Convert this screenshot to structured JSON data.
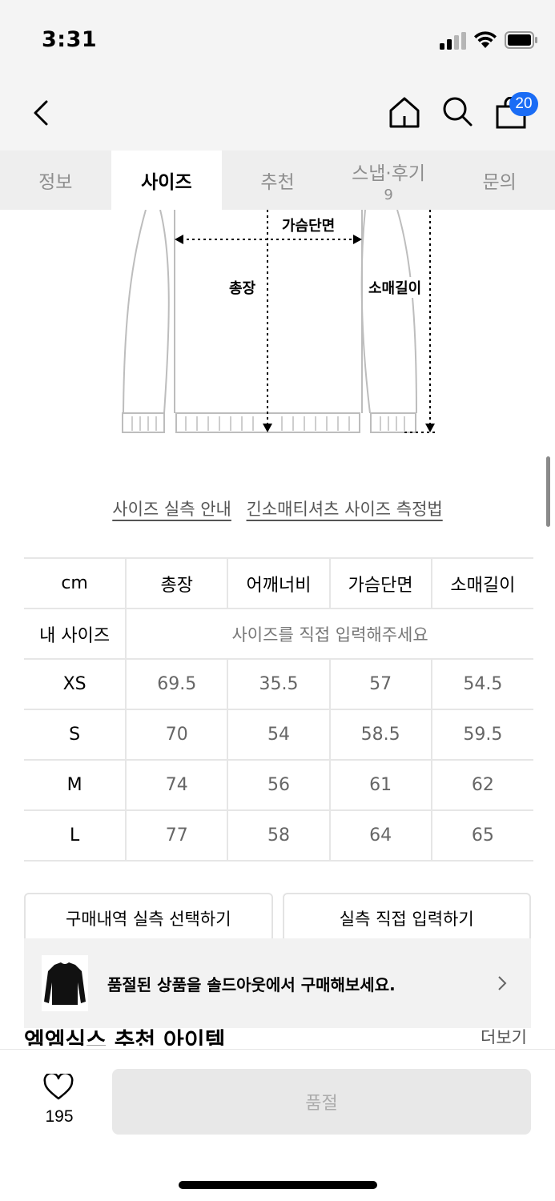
{
  "status": {
    "time": "3:31"
  },
  "header": {
    "cart_count": "20"
  },
  "tabs": [
    {
      "label": "정보"
    },
    {
      "label": "사이즈"
    },
    {
      "label": "추천"
    },
    {
      "label": "스냅·후기",
      "count": "9"
    },
    {
      "label": "문의"
    }
  ],
  "diagram": {
    "chest_label": "가슴단면",
    "length_label": "총장",
    "sleeve_label": "소매길이"
  },
  "guide_links": [
    "사이즈 실측 안내",
    "긴소매티셔츠 사이즈 측정법"
  ],
  "size_table": {
    "headers": [
      "cm",
      "총장",
      "어깨너비",
      "가슴단면",
      "소매길이"
    ],
    "my_size_label": "내 사이즈",
    "my_size_placeholder": "사이즈를 직접 입력해주세요",
    "rows": [
      [
        "XS",
        "69.5",
        "35.5",
        "57",
        "54.5"
      ],
      [
        "S",
        "70",
        "54",
        "58.5",
        "59.5"
      ],
      [
        "M",
        "74",
        "56",
        "61",
        "62"
      ],
      [
        "L",
        "77",
        "58",
        "64",
        "65"
      ]
    ]
  },
  "buttons": {
    "purchase_history": "구매내역 실측 선택하기",
    "direct_input": "실측 직접 입력하기"
  },
  "soldout_banner": {
    "text": "품절된 상품을 솔드아웃에서 구매해보세요."
  },
  "section": {
    "title": "엠엠식스 추천 아이템",
    "more": "더보기"
  },
  "bottom_bar": {
    "like_count": "195",
    "soldout_label": "품절"
  },
  "colors": {
    "accent": "#1a6cf5",
    "tab_bg": "#eeeeee",
    "disabled_btn": "#e8e8e8"
  }
}
